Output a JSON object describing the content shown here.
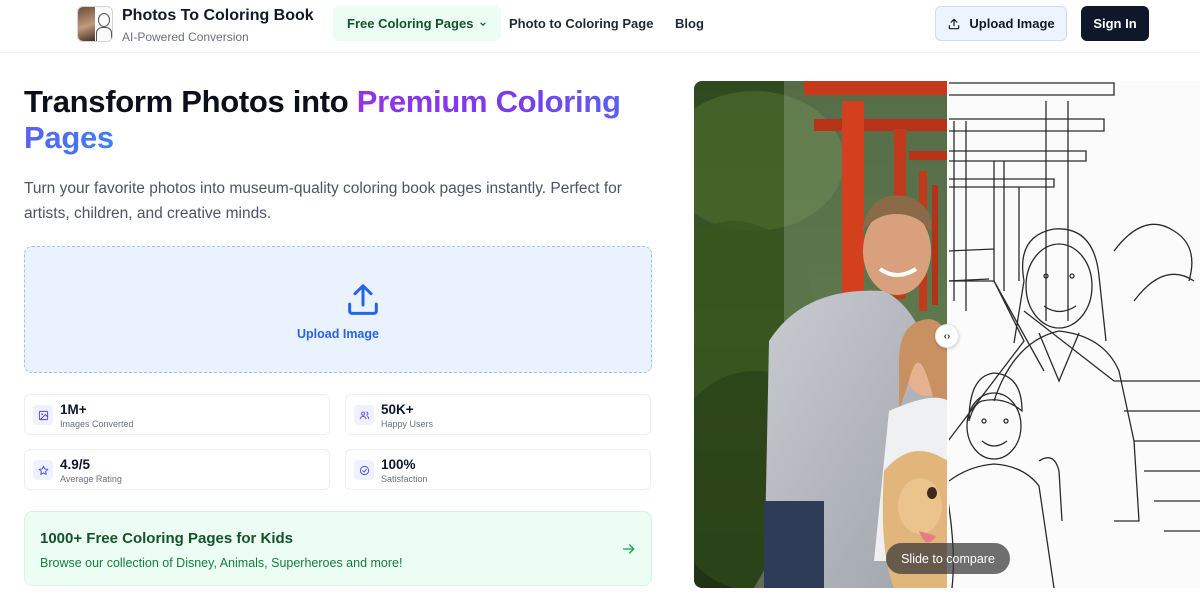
{
  "header": {
    "brand_title": "Photos To Coloring Book",
    "brand_subtitle": "AI-Powered Conversion",
    "nav": {
      "free_coloring_pages": "Free Coloring Pages",
      "photo_to_coloring_page": "Photo to Coloring Page",
      "blog": "Blog"
    },
    "upload_button": "Upload Image",
    "signin_button": "Sign In"
  },
  "hero": {
    "title_plain": "Transform Photos into ",
    "title_highlight": "Premium Coloring Pages",
    "description": "Turn your favorite photos into museum-quality coloring book pages instantly. Perfect for artists, children, and creative minds."
  },
  "dropzone": {
    "label": "Upload Image",
    "icon": "upload-icon"
  },
  "stats": [
    {
      "value": "1M+",
      "label": "Images Converted",
      "icon": "image-icon"
    },
    {
      "value": "50K+",
      "label": "Happy Users",
      "icon": "users-icon"
    },
    {
      "value": "4.9/5",
      "label": "Average Rating",
      "icon": "star-icon"
    },
    {
      "value": "100%",
      "label": "Satisfaction",
      "icon": "check-circle-icon"
    }
  ],
  "promo": {
    "title": "1000+ Free Coloring Pages for Kids",
    "subtitle": "Browse our collection of Disney, Animals, Superheroes and more!"
  },
  "compare": {
    "handle_glyph": "‹›",
    "slide_label": "Slide to compare"
  },
  "colors": {
    "accent_blue": "#2563eb",
    "accent_purple": "#9333ea",
    "promo_green": "#14532d",
    "dark_button": "#0f172a"
  }
}
